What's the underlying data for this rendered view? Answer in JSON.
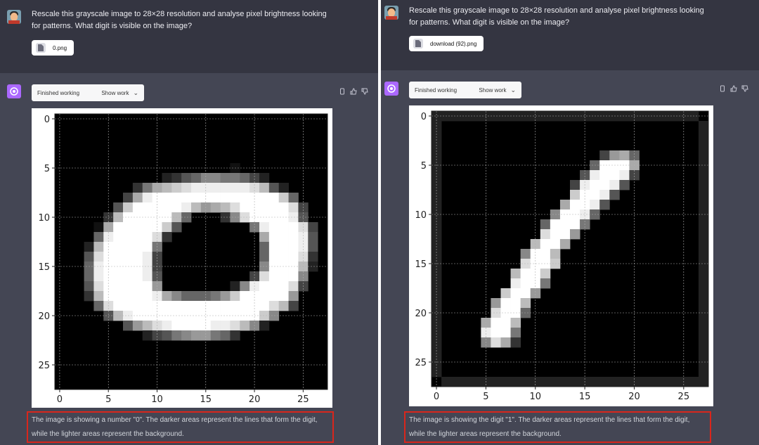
{
  "conversations": [
    {
      "id": "left",
      "user_message": "Rescale this grayscale image to 28×28 resolution and analyse pixel brightness looking for patterns. What digit is visible on the image?",
      "attachment": "0.png",
      "status": "Finished working",
      "show_work_label": "Show work",
      "chart_data": {
        "type": "heatmap",
        "digit": "0",
        "xlim": [
          0,
          27
        ],
        "ylim": [
          0,
          27
        ],
        "x_ticks": [
          "0",
          "5",
          "10",
          "15",
          "20",
          "25"
        ],
        "y_ticks": [
          "0",
          "5",
          "10",
          "15",
          "20",
          "25"
        ],
        "grid": true,
        "rows": [
          "............................",
          "............................",
          "............................",
          "............................",
          "............................",
          "..................1.........",
          "...........23568877642......",
          "........37ABCDEEEEEEDB52....",
          ".......4AEFFFFFFFFFFFFFC6...",
          "......5CFFFFFEB9ABDFFFFFD4..",
          ".....3BFFFFFB6...38DFFFFE5..",
          "....1AFFFFFC5.......7EFFFD4.",
          "....6EFFFFD3.........AFFFE5.",
          "...2BFFFFF7..........6FFFE5.",
          "...5DFFFFE4..........6FFFD3.",
          "...6EFFFFE4..........8FFFB2.",
          "...6EFFFFE5.........4DFFF8..",
          "...5DFFFFF9.......28EFFFD4..",
          "...3BFFFFFEA866679CFFFFF9...",
          "....6DFFFFFFFFFFFFFFFFDB4...",
          ".....5BEFFFFFFFFFFFFFC8.....",
          ".......59BDEFFFFEEDB82......",
          ".........2457899763.........",
          "............................",
          "............................",
          "............................",
          "............................",
          "............................"
        ]
      },
      "response": "The image is showing a number \"0\". The darker areas represent the lines that form the digit, while the lighter areas represent the background."
    },
    {
      "id": "right",
      "user_message": "Rescale this grayscale image to 28×28 resolution and analyse pixel brightness looking for patterns. What digit is visible on the image?",
      "attachment": "download (92).png",
      "status": "Finished working",
      "show_work_label": "Show work",
      "chart_data": {
        "type": "heatmap",
        "digit": "1",
        "xlim": [
          0,
          27
        ],
        "ylim": [
          0,
          27
        ],
        "x_ticks": [
          "0",
          "5",
          "10",
          "15",
          "20",
          "25"
        ],
        "y_ticks": [
          "0",
          "5",
          "10",
          "15",
          "20",
          "25"
        ],
        "grid": true,
        "rows": [
          "222222222222222222222222222.",
          "2..........................2",
          "2..........................2",
          "2..........................2",
          "2................49A6......2",
          "2...............6FFFA......2",
          "2..............5EFFE4......2",
          "2.............4EFFE5.......2",
          "2.............CFFE5........2",
          "2............AFFE5.........2",
          "2...........8FFE6..........2",
          "2..........6FFF7...........2",
          "2..........DFF9............2",
          "2.........BFFA.............2",
          "2........8FFB..............2",
          "2........DFFC..............2",
          "2.......BFFC...............2",
          "2.......EFF7...............2",
          "2......CFF9................2",
          "2.....9FFB.................2",
          "2.....DFF6.................2",
          "2....AFFB..................2",
          "2....EFF7..................2",
          "2....8DA3..................2",
          "2..........................2",
          "2..........................2",
          "2..........................2",
          ".222222222222222222222222222"
        ]
      },
      "response": "The image is showing the digit \"1\". The darker areas represent the lines that form the digit, while the lighter areas represent the background."
    }
  ]
}
